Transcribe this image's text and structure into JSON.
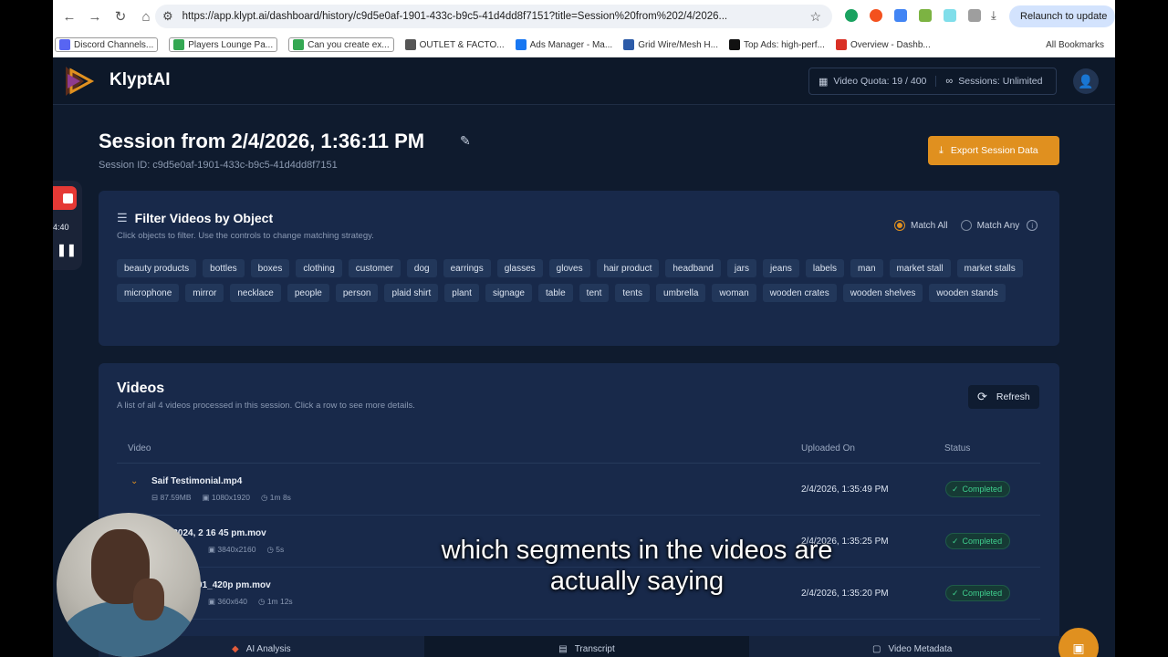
{
  "browser": {
    "url": "https://app.klypt.ai/dashboard/history/c9d5e0af-1901-433c-b9c5-41d4dd8f7151?title=Session%20from%202/4/2026...",
    "relaunch_label": "Relaunch to update",
    "bookmarks": [
      {
        "label": "Discord Channels...",
        "color": "#5865f2",
        "boxed": true
      },
      {
        "label": "Players Lounge Pa...",
        "color": "#34a853",
        "boxed": true
      },
      {
        "label": "Can you create ex...",
        "color": "#34a853",
        "boxed": true
      },
      {
        "label": "OUTLET & FACTO...",
        "color": "#555555",
        "boxed": false
      },
      {
        "label": "Ads Manager - Ma...",
        "color": "#1877f2",
        "boxed": false
      },
      {
        "label": "Grid Wire/Mesh H...",
        "color": "#2c5ba8",
        "boxed": false
      },
      {
        "label": "Top Ads: high-perf...",
        "color": "#111111",
        "boxed": false
      },
      {
        "label": "Overview - Dashb...",
        "color": "#d93025",
        "boxed": false
      }
    ],
    "all_bookmarks": "All Bookmarks"
  },
  "app": {
    "brand": "KlyptAI",
    "quota_label": "Video Quota:",
    "quota_value": "19 / 400",
    "sessions_label": "Sessions:",
    "sessions_value": "Unlimited"
  },
  "session": {
    "title": "Session from 2/4/2026, 1:36:11 PM",
    "id_text": "Session ID: c9d5e0af-1901-433c-b9c5-41d4dd8f7151",
    "export_label": "Export Session Data"
  },
  "filter": {
    "heading": "Filter Videos by Object",
    "subtext": "Click objects to filter. Use the controls to change matching strategy.",
    "match_all": "Match All",
    "match_any": "Match Any",
    "objects": [
      "beauty products",
      "bottles",
      "boxes",
      "clothing",
      "customer",
      "dog",
      "earrings",
      "glasses",
      "gloves",
      "hair product",
      "headband",
      "jars",
      "jeans",
      "labels",
      "man",
      "market stall",
      "market stalls",
      "microphone",
      "mirror",
      "necklace",
      "people",
      "person",
      "plaid shirt",
      "plant",
      "signage",
      "table",
      "tent",
      "tents",
      "umbrella",
      "woman",
      "wooden crates",
      "wooden shelves",
      "wooden stands"
    ]
  },
  "videos": {
    "heading": "Videos",
    "subtext": "A list of all 4 videos processed in this session. Click a row to see more details.",
    "refresh_label": "Refresh",
    "columns": {
      "video": "Video",
      "uploaded": "Uploaded On",
      "status": "Status"
    },
    "rows": [
      {
        "name": "Saif Testimonial.mp4",
        "size": "87.59MB",
        "res": "1080x1920",
        "dur": "1m 8s",
        "uploaded": "2/4/2026, 1:35:49 PM",
        "status": "Completed"
      },
      {
        "name": "4-12-2024, 2 16 45 pm.mov",
        "size": "",
        "res": "3840x2160",
        "dur": "5s",
        "uploaded": "2/4/2026, 1:35:25 PM",
        "status": "Completed"
      },
      {
        "name": "2024, 1 41 01_420p pm.mov",
        "size": "",
        "res": "360x640",
        "dur": "1m 12s",
        "uploaded": "2/4/2026, 1:35:20 PM",
        "status": "Completed"
      }
    ]
  },
  "bottom_tabs": [
    "AI Analysis",
    "Transcript",
    "Video Metadata"
  ],
  "recorder": {
    "time": "4:40"
  },
  "caption": {
    "line1": "which segments in the videos are",
    "line2": "actually saying"
  },
  "colors": {
    "accent": "#e0901f",
    "background": "#0f1b2e",
    "card": "#18294a",
    "success": "#3fcf8e"
  }
}
